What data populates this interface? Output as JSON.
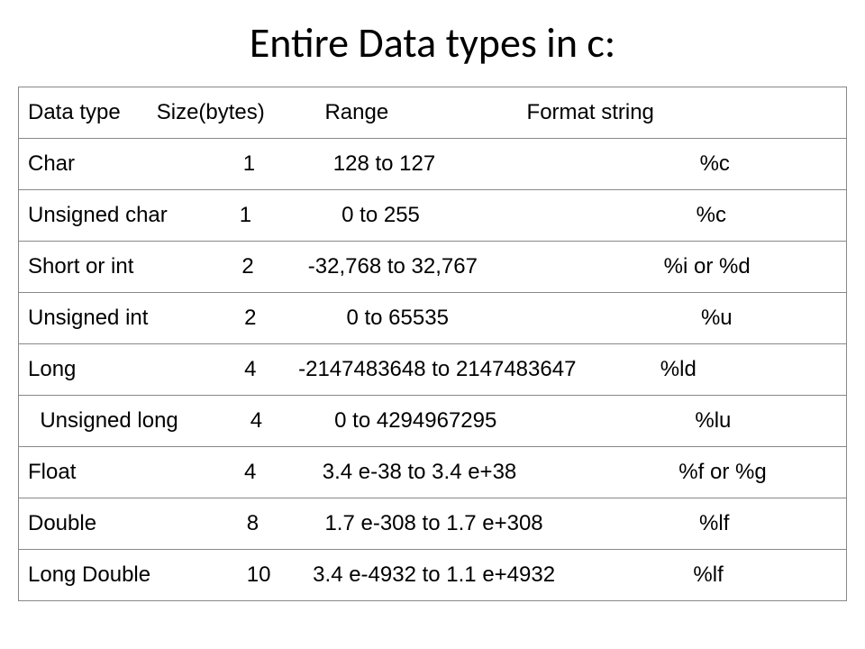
{
  "title": "Entire Data types in c:",
  "header": "Data type      Size(bytes)          Range                       Format string",
  "rows": [
    "Char                            1             128 to 127                                            %c",
    "Unsigned char            1               0 to 255                                              %c",
    "Short or int                  2         -32,768 to 32,767                               %i or %d",
    "Unsigned int                2               0 to 65535                                          %u",
    "Long                            4       -2147483648 to 2147483647              %ld",
    "  Unsigned long            4            0 to 4294967295                                 %lu",
    "Float                            4           3.4 e-38 to 3.4 e+38                           %f or %g",
    "Double                         8           1.7 e-308 to 1.7 e+308                          %lf",
    "Long Double                10       3.4 e-4932 to 1.1 e+4932                       %lf"
  ],
  "chart_data": {
    "type": "table",
    "title": "Entire Data types in c:",
    "columns": [
      "Data type",
      "Size(bytes)",
      "Range",
      "Format string"
    ],
    "data": [
      {
        "Data type": "Char",
        "Size(bytes)": 1,
        "Range": "128 to 127",
        "Format string": "%c"
      },
      {
        "Data type": "Unsigned char",
        "Size(bytes)": 1,
        "Range": "0 to 255",
        "Format string": "%c"
      },
      {
        "Data type": "Short or int",
        "Size(bytes)": 2,
        "Range": "-32,768 to 32,767",
        "Format string": "%i or %d"
      },
      {
        "Data type": "Unsigned int",
        "Size(bytes)": 2,
        "Range": "0 to 65535",
        "Format string": "%u"
      },
      {
        "Data type": "Long",
        "Size(bytes)": 4,
        "Range": "-2147483648 to 2147483647",
        "Format string": "%ld"
      },
      {
        "Data type": "Unsigned long",
        "Size(bytes)": 4,
        "Range": "0 to 4294967295",
        "Format string": "%lu"
      },
      {
        "Data type": "Float",
        "Size(bytes)": 4,
        "Range": "3.4 e-38 to 3.4 e+38",
        "Format string": "%f or %g"
      },
      {
        "Data type": "Double",
        "Size(bytes)": 8,
        "Range": "1.7 e-308 to 1.7 e+308",
        "Format string": "%lf"
      },
      {
        "Data type": "Long Double",
        "Size(bytes)": 10,
        "Range": "3.4 e-4932 to 1.1 e+4932",
        "Format string": "%lf"
      }
    ]
  }
}
